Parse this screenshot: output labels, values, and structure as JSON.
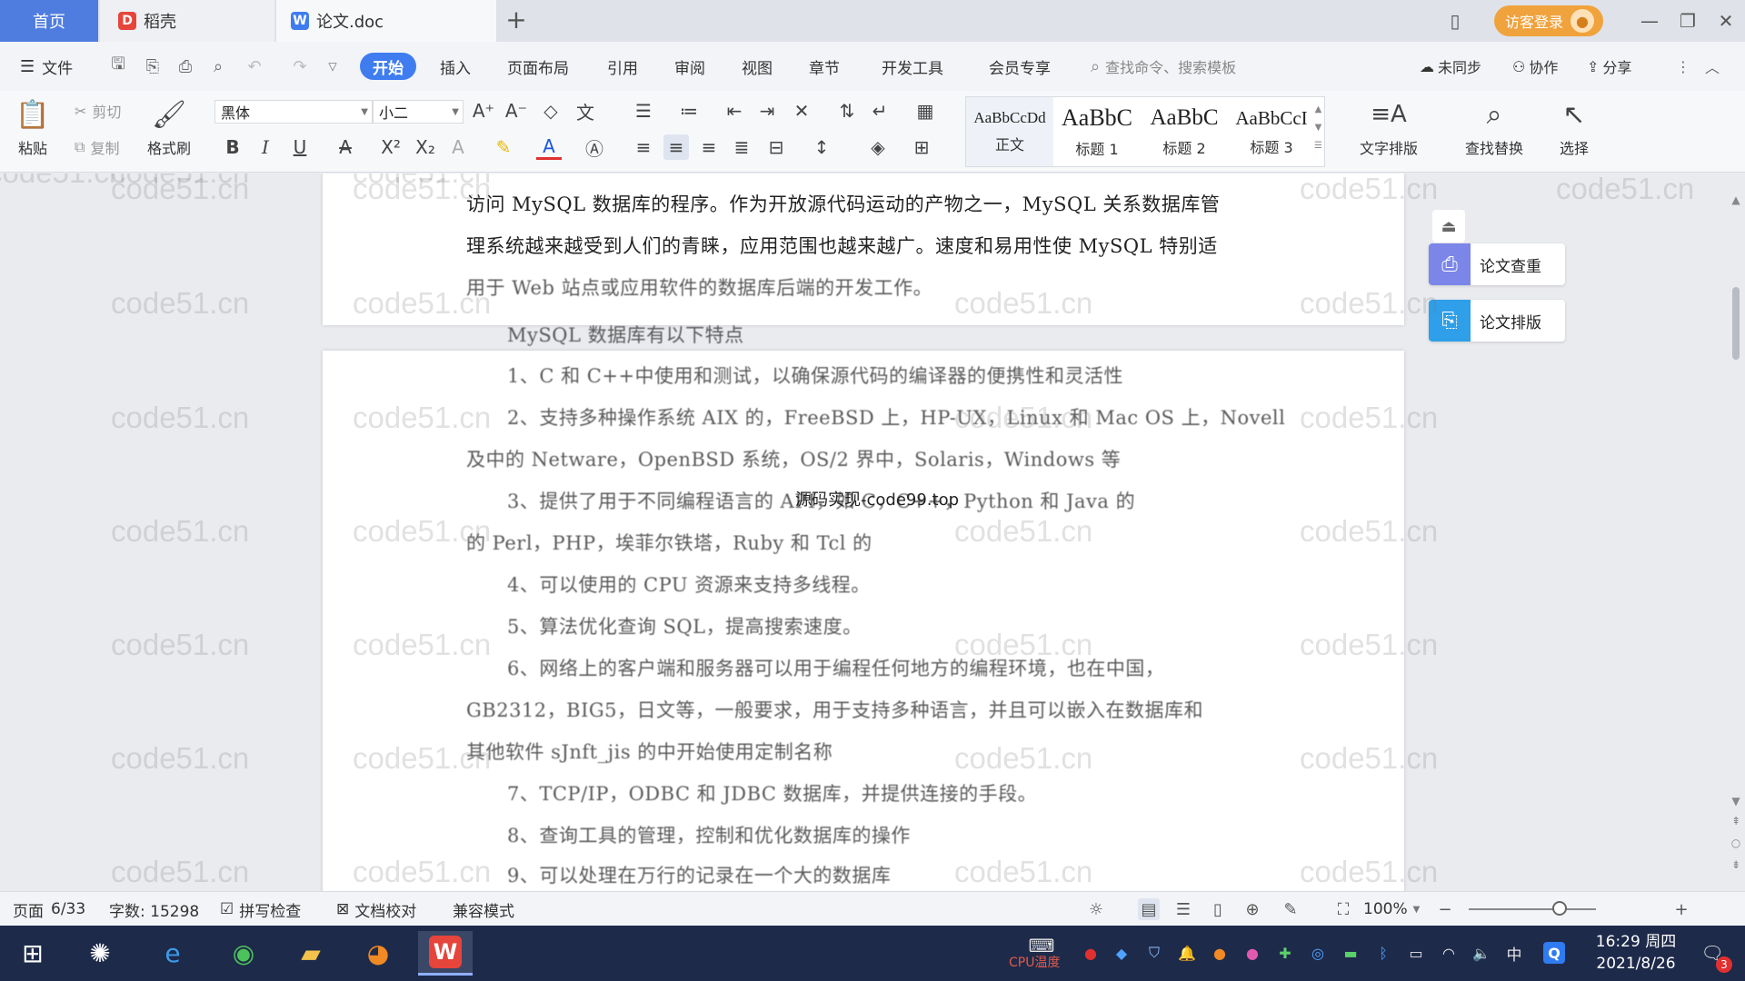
{
  "tabs": {
    "home": "首页",
    "docer": "稻壳",
    "doc": "论文.doc"
  },
  "account": {
    "guest_login": "访客登录"
  },
  "menu": {
    "file": "文件",
    "items": [
      "开始",
      "插入",
      "页面布局",
      "引用",
      "审阅",
      "视图",
      "章节",
      "开发工具",
      "会员专享"
    ],
    "search_placeholder": "查找命令、搜索模板",
    "sync": "未同步",
    "collab": "协作",
    "share": "分享"
  },
  "ribbon": {
    "paste": "粘贴",
    "cut": "剪切",
    "copy": "复制",
    "format_painter": "格式刷",
    "font_name": "黑体",
    "font_size": "小二",
    "styles": [
      {
        "preview": "AaBbCcDd",
        "name": "正文"
      },
      {
        "preview": "AaBbC",
        "name": "标题 1"
      },
      {
        "preview": "AaBbC",
        "name": "标题 2"
      },
      {
        "preview": "AaBbCcI",
        "name": "标题 3"
      }
    ],
    "text_layout": "文字排版",
    "find_replace": "查找替换",
    "select": "选择"
  },
  "side_panel": {
    "check": "论文查重",
    "layout": "论文排版"
  },
  "watermark": "code51.cn",
  "overlay_text": "源码实现-code99.top",
  "document": {
    "top_lines": [
      "访问 MySQL 数据库的程序。作为开放源代码运动的产物之一，MySQL 关系数据库管",
      "理系统越来越受到人们的青睐，应用范围也越来越广。速度和易用性使 MySQL 特别适",
      "用于 Web 站点或应用软件的数据库后端的开发工作。"
    ],
    "intro_line": "MySQL 数据库有以下特点",
    "main_lines": [
      {
        "text": "1、C 和 C++中使用和测试，以确保源代码的编译器的便携性和灵活性",
        "indent": true
      },
      {
        "text": "2、支持多种操作系统 AIX 的，FreeBSD 上，HP-UX，Linux 和 Mac OS 上，Novell",
        "indent": true
      },
      {
        "text": "及中的 Netware，OpenBSD 系统，OS/2 界中，Solaris，Windows 等",
        "indent": false
      },
      {
        "text": "3、提供了用于不同编程语言的 API，如 C，C++，Python 和 Java 的",
        "indent": true
      },
      {
        "text": "的 Perl，PHP，埃菲尔铁塔，Ruby 和 Tcl 的",
        "indent": false
      },
      {
        "text": "4、可以使用的 CPU 资源来支持多线程。",
        "indent": true
      },
      {
        "text": "5、算法优化查询 SQL，提高搜索速度。",
        "indent": true
      },
      {
        "text": "6、网络上的客户端和服务器可以用于编程任何地方的编程环境，也在中国，",
        "indent": true
      },
      {
        "text": "GB2312，BIG5，日文等，一般要求，用于支持多种语言，并且可以嵌入在数据库和",
        "indent": false
      },
      {
        "text": "其他软件 sJnft_jis 的中开始使用定制名称",
        "indent": false
      },
      {
        "text": "7、TCP/IP，ODBC 和 JDBC 数据库，并提供连接的手段。",
        "indent": true
      },
      {
        "text": "8、查询工具的管理，控制和优化数据库的操作",
        "indent": true
      },
      {
        "text": "9、可以处理在万行的记录在一个大的数据库",
        "indent": true
      }
    ]
  },
  "status": {
    "page_label": "页面",
    "page_value": "6/33",
    "word_count": "字数: 15298",
    "spell_check": "拼写检查",
    "doc_proof": "文档校对",
    "compat_mode": "兼容模式",
    "zoom": "100%"
  },
  "taskbar": {
    "time": "16:29 周四",
    "date": "2021/8/26",
    "cpu_label": "CPU温度",
    "ime": "中",
    "notification_count": "3"
  },
  "colors": {
    "accent": "#3f7cf0",
    "tab_home": "#4f7ddf",
    "guest": "#f0a23c",
    "taskbar": "#1e2a4a",
    "docer_red": "#e5453b",
    "side_check": "#7b86e8",
    "side_layout": "#2e9fe8"
  }
}
